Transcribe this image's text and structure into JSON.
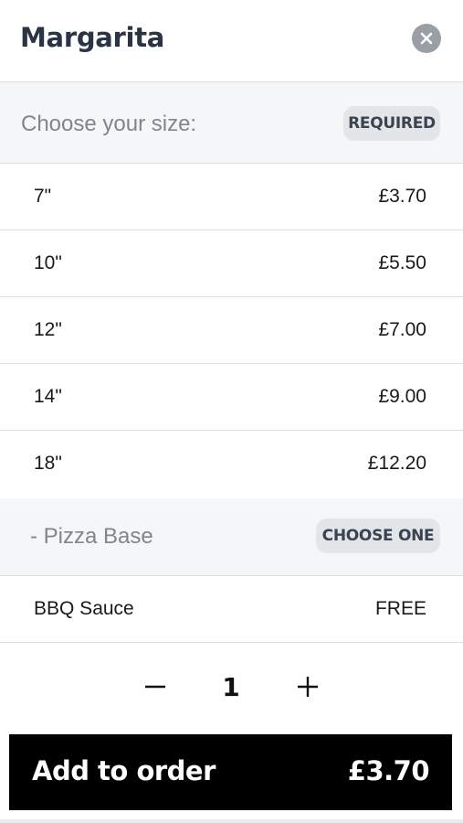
{
  "header": {
    "title": "Margarita",
    "close_icon": "close-icon"
  },
  "size_section": {
    "label": "Choose your size:",
    "badge": "REQUIRED",
    "options": [
      {
        "name": "7\"",
        "price": "£3.70"
      },
      {
        "name": "10\"",
        "price": "£5.50"
      },
      {
        "name": "12\"",
        "price": "£7.00"
      },
      {
        "name": "14\"",
        "price": "£9.00"
      },
      {
        "name": "18\"",
        "price": "£12.20"
      }
    ]
  },
  "base_section": {
    "label": "- Pizza Base",
    "badge": "CHOOSE ONE",
    "options": [
      {
        "name": "BBQ Sauce",
        "price": "FREE"
      }
    ]
  },
  "quantity": {
    "value": "1",
    "minus_icon": "minus-icon",
    "plus_icon": "plus-icon"
  },
  "add_button": {
    "label": "Add to order",
    "total": "£3.70"
  },
  "colors": {
    "title": "#2b3445",
    "section_bg": "#f4f6f8",
    "badge_bg": "#e3e5e8",
    "button_bg": "#000000",
    "close_bg": "#9a9ea5"
  }
}
